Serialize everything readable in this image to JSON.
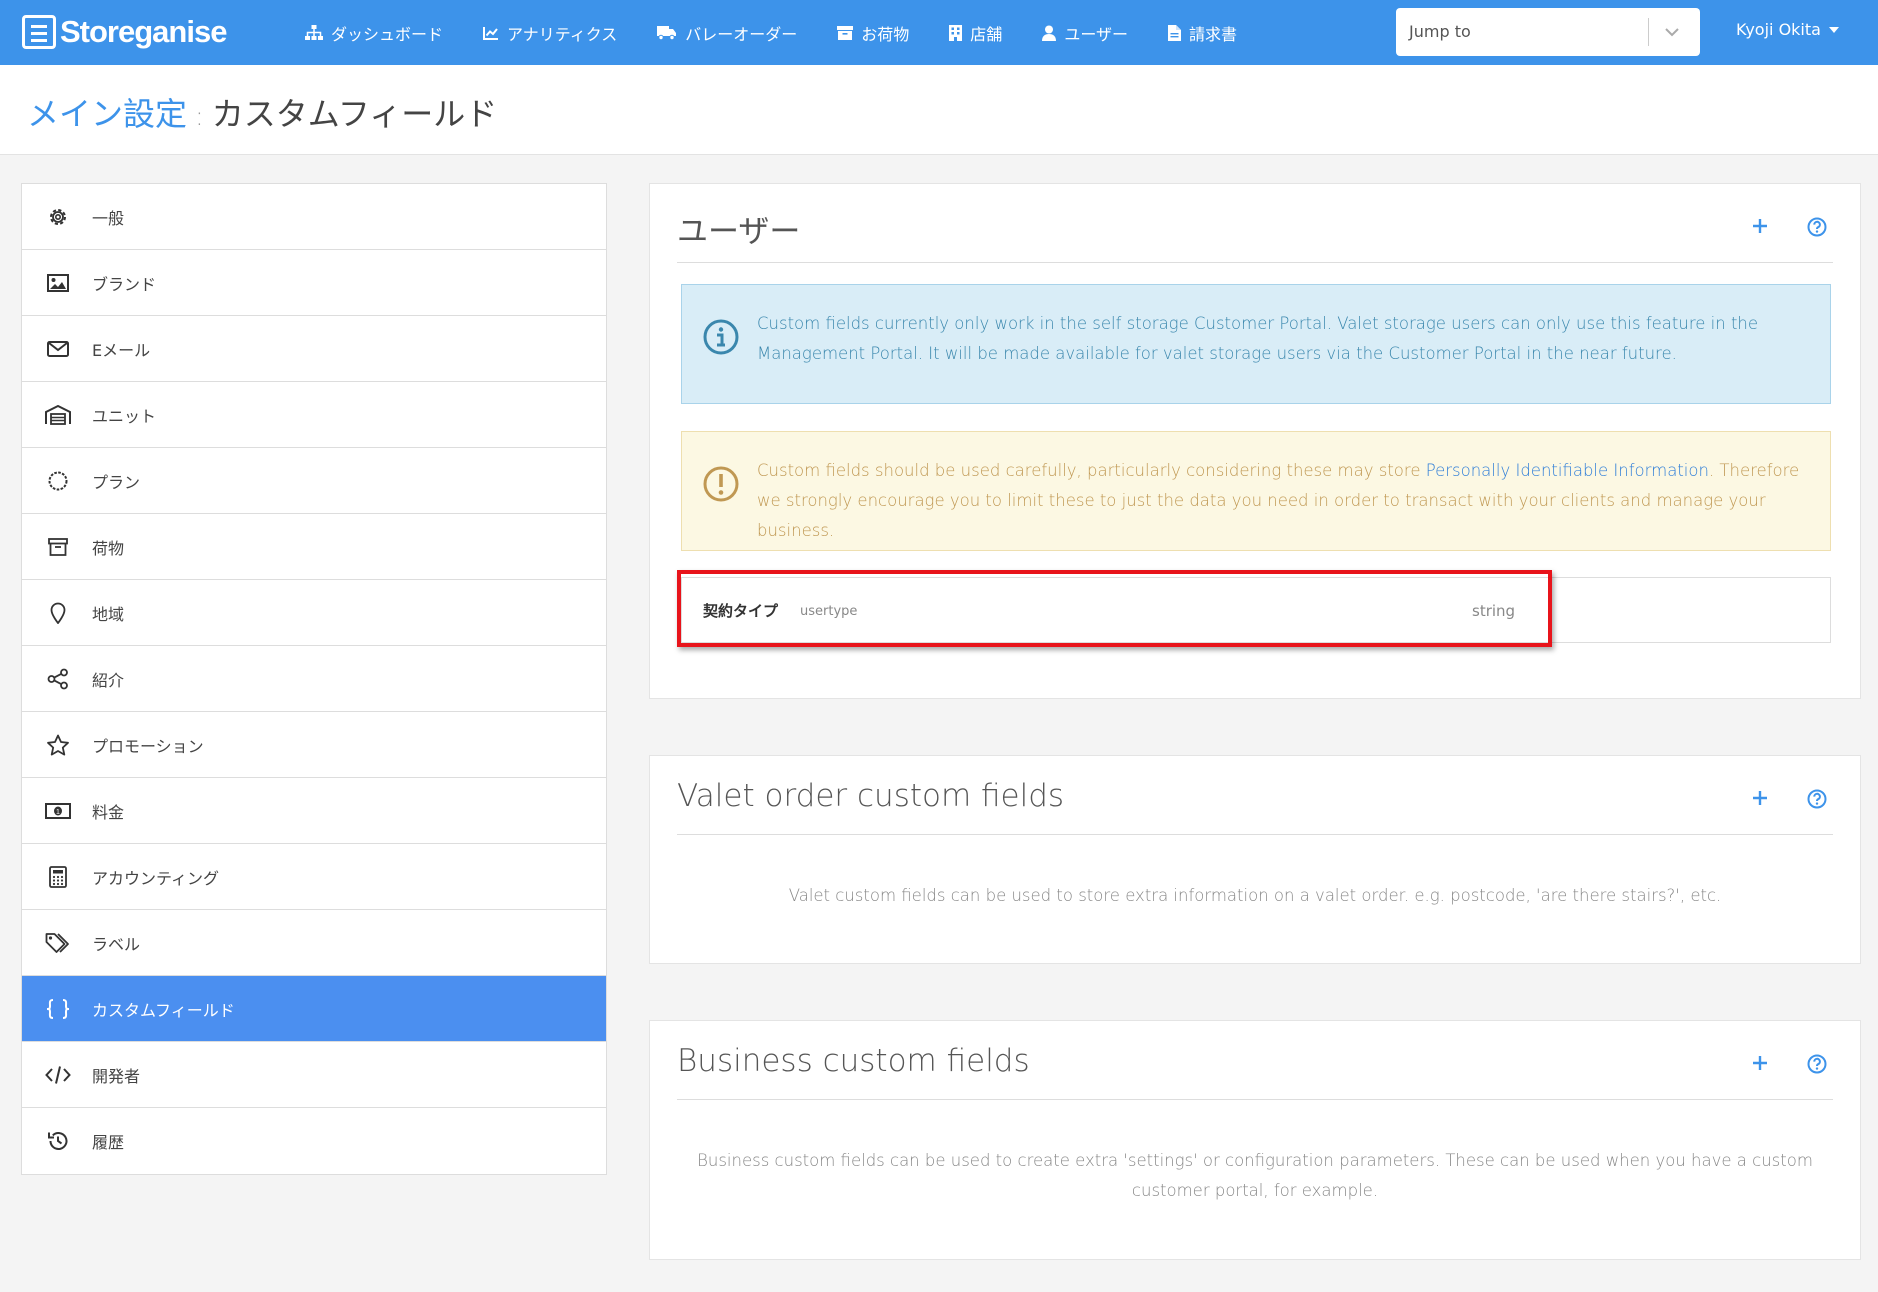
{
  "brand": {
    "name": "Storeganise"
  },
  "nav": [
    {
      "label": "ダッシュボード",
      "icon": "sitemap-icon"
    },
    {
      "label": "アナリティクス",
      "icon": "chart-icon"
    },
    {
      "label": "バレーオーダー",
      "icon": "truck-icon"
    },
    {
      "label": "お荷物",
      "icon": "archive-icon"
    },
    {
      "label": "店舗",
      "icon": "building-icon"
    },
    {
      "label": "ユーザー",
      "icon": "user-icon"
    },
    {
      "label": "請求書",
      "icon": "invoice-icon"
    }
  ],
  "jump": {
    "placeholder": "Jump to"
  },
  "user": {
    "name": "Kyoji Okita"
  },
  "breadcrumb": {
    "parent": "メイン設定",
    "separator": ":",
    "current": "カスタムフィールド"
  },
  "sidebar": {
    "items": [
      {
        "label": "一般",
        "icon": "gear-icon"
      },
      {
        "label": "ブランド",
        "icon": "image-icon"
      },
      {
        "label": "Eメール",
        "icon": "envelope-icon"
      },
      {
        "label": "ユニット",
        "icon": "warehouse-icon"
      },
      {
        "label": "プラン",
        "icon": "circle-icon"
      },
      {
        "label": "荷物",
        "icon": "archive-icon"
      },
      {
        "label": "地域",
        "icon": "map-pin-icon"
      },
      {
        "label": "紹介",
        "icon": "share-icon"
      },
      {
        "label": "プロモーション",
        "icon": "star-icon"
      },
      {
        "label": "料金",
        "icon": "money-icon"
      },
      {
        "label": "アカウンティング",
        "icon": "calculator-icon"
      },
      {
        "label": "ラベル",
        "icon": "tags-icon"
      },
      {
        "label": "カスタムフィールド",
        "icon": "braces-icon"
      },
      {
        "label": "開発者",
        "icon": "code-icon"
      },
      {
        "label": "履歴",
        "icon": "history-icon"
      }
    ],
    "active": "カスタムフィールド"
  },
  "panels": {
    "users": {
      "title": "ユーザー",
      "info_alert": "Custom fields currently only work in the self storage Customer Portal. Valet storage users can only use this feature in the Management Portal. It will be made available for valet storage users via the Customer Portal in the near future.",
      "warning_alert": {
        "before": "Custom fields should be used carefully, particularly considering these may store ",
        "link": "Personally Identifiable Information",
        "after": ". Therefore we strongly encourage you to limit these to just the data you need in order to transact with your clients and manage your business."
      },
      "fields": [
        {
          "label": "契約タイプ",
          "key": "usertype",
          "type": "string"
        }
      ]
    },
    "valet": {
      "title": "Valet order custom fields",
      "description": "Valet custom fields can be used to store extra information on a valet order. e.g. postcode, 'are there stairs?', etc."
    },
    "business": {
      "title": "Business custom fields",
      "description": "Business custom fields can be used to create extra 'settings' or configuration parameters. These can be used when you have a custom customer portal, for example."
    }
  },
  "colors": {
    "primary": "#3d93ea",
    "active_sidebar": "#4b8ff0",
    "highlight": "#e8141b"
  }
}
